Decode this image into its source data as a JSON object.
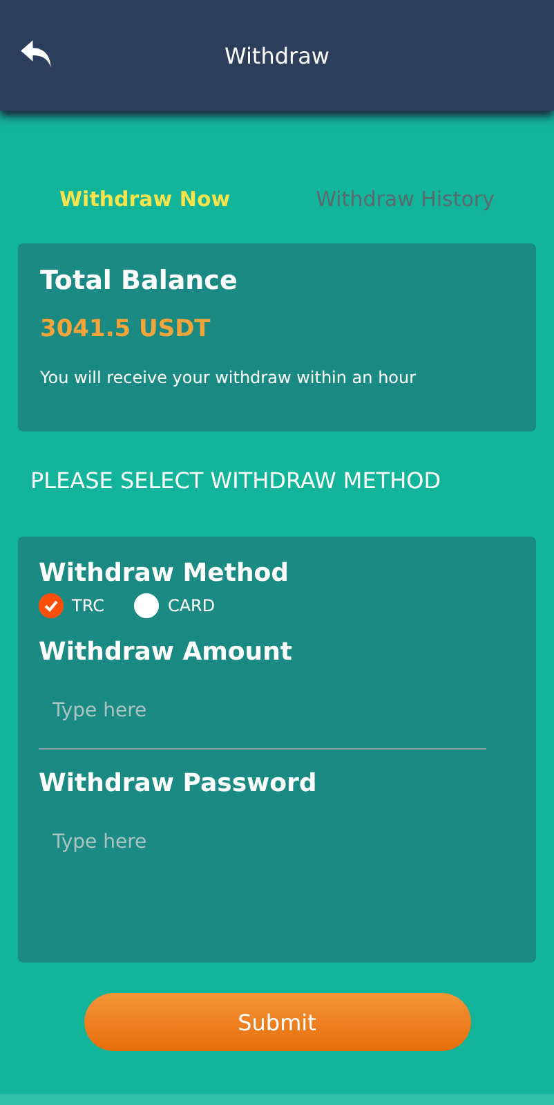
{
  "header": {
    "title": "Withdraw"
  },
  "tabs": [
    {
      "label": "Withdraw Now",
      "selected": true
    },
    {
      "label": "Withdraw History",
      "selected": false
    }
  ],
  "balance": {
    "title": "Total Balance",
    "amount": "3041.5 USDT",
    "note": "You will receive your withdraw within an hour"
  },
  "instruction": "PLEASE SELECT WITHDRAW METHOD",
  "method": {
    "label": "Withdraw Method",
    "options": [
      {
        "label": "TRC",
        "selected": true
      },
      {
        "label": "CARD",
        "selected": false
      }
    ]
  },
  "fields": [
    {
      "label": "Withdraw Amount",
      "placeholder": "Type here",
      "underline": true
    },
    {
      "label": "Withdraw Password",
      "placeholder": "Type here",
      "underline": false
    }
  ],
  "submit": "Submit"
}
